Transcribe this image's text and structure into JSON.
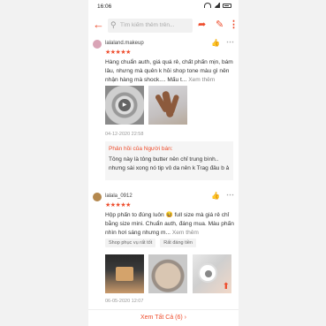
{
  "status_bar": {
    "time": "16:06"
  },
  "topbar": {
    "back_icon": "arrow-left-icon",
    "search_placeholder": "Tìm kiếm thêm trên...",
    "share_icon": "share-icon",
    "edit_icon": "edit-icon",
    "more_icon": "more-vertical-icon"
  },
  "colors": {
    "accent": "#ee4d2d",
    "star": "#ee4d2d",
    "muted": "#999999"
  },
  "reviews": [
    {
      "username": "lalaland.makeup",
      "stars": "★★★★★",
      "text": "Hàng chuẩn auth, giá quá rẻ, chất phấn mịn, bám lâu, nhưng mà quên k hỏi shop tone màu gì nên nhận hàng mà shock.... Mấu t...",
      "more_label": "Xem thêm",
      "date": "04-12-2020 22:58",
      "reply_title": "Phản hồi của Người bán:",
      "reply_text": "Tông này là tông butter nên chỉ trung bình.. nhưng sài xong nó tip vô da nên k Trag đâu b ả"
    },
    {
      "username": "lalala_0912",
      "stars": "★★★★★",
      "text": "Hộp phấn to đúng luôn 😆 full size mà giá rẻ chỉ bằng size mini. Chuẩn auth, đáng mua. Màu phấn nhìn hơi sáng nhưng m...",
      "more_label": "Xem thêm",
      "tags": [
        "Shop phục vụ rất tốt",
        "Rất đáng tiền"
      ],
      "date": "06-05-2020 12:07"
    }
  ],
  "footer": {
    "see_all": "Xem Tất Cả (6) ›"
  }
}
